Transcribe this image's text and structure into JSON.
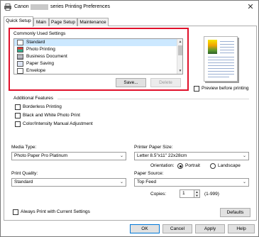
{
  "window": {
    "title_prefix": "Canon",
    "title_suffix": "series Printing Preferences",
    "close_glyph": "✕"
  },
  "tabs": [
    {
      "label": "Quick Setup",
      "active": true
    },
    {
      "label": "Main",
      "active": false
    },
    {
      "label": "Page Setup",
      "active": false
    },
    {
      "label": "Maintenance",
      "active": false
    }
  ],
  "commonly_used": {
    "title": "Commonly Used Settings",
    "items": [
      "Standard",
      "Photo Printing",
      "Business Document",
      "Paper Saving",
      "Envelope"
    ],
    "selected_index": 0,
    "save_label": "Save...",
    "delete_label": "Delete",
    "highlight_color": "#e0102a"
  },
  "preview": {
    "checkbox_label": "Preview before printing",
    "checked": false
  },
  "additional_features": {
    "title": "Additional Features",
    "options": [
      {
        "label": "Borderless Printing",
        "checked": false
      },
      {
        "label": "Black and White Photo Print",
        "checked": false
      },
      {
        "label": "Color/Intensity Manual Adjustment",
        "checked": false
      }
    ]
  },
  "media_type": {
    "label": "Media Type:",
    "value": "Photo Paper Pro Platinum"
  },
  "printer_paper_size": {
    "label": "Printer Paper Size:",
    "value": "Letter 8.5\"x11\" 22x28cm"
  },
  "orientation": {
    "label": "Orientation:",
    "portrait_label": "Portrait",
    "landscape_label": "Landscape",
    "selected": "Portrait"
  },
  "print_quality": {
    "label": "Print Quality:",
    "value": "Standard"
  },
  "paper_source": {
    "label": "Paper Source:",
    "value": "Top Feed"
  },
  "copies": {
    "label": "Copies:",
    "value": "1",
    "range": "(1-999)"
  },
  "always_print": {
    "label": "Always Print with Current Settings",
    "checked": false
  },
  "buttons": {
    "defaults": "Defaults",
    "ok": "OK",
    "cancel": "Cancel",
    "apply": "Apply",
    "help": "Help"
  }
}
